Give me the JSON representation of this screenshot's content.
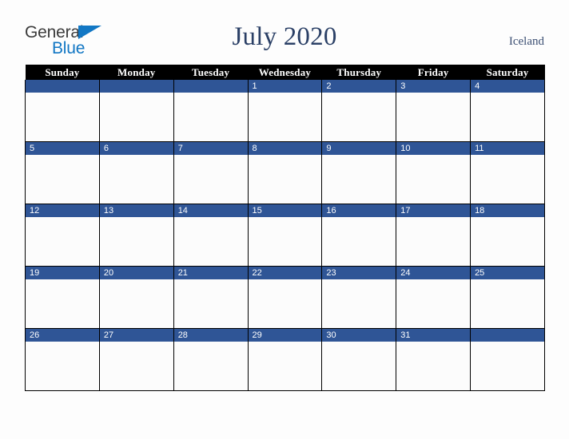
{
  "brand": {
    "name_part1": "General",
    "name_part2": "Blue",
    "triangle_icon": "triangle-icon"
  },
  "header": {
    "title": "July 2020",
    "region": "Iceland"
  },
  "colors": {
    "date_bar": "#2F5596",
    "header_row": "#000000",
    "title_text": "#2B4066",
    "region_text": "#3C4F73",
    "brand_blue": "#1277C4",
    "cell_background": "#FCFCFC",
    "page_background": "#FDFDFD"
  },
  "calendar": {
    "month": "July",
    "year": "2020",
    "weekday_headers": [
      "Sunday",
      "Monday",
      "Tuesday",
      "Wednesday",
      "Thursday",
      "Friday",
      "Saturday"
    ],
    "weeks": [
      [
        "",
        "",
        "",
        "1",
        "2",
        "3",
        "4"
      ],
      [
        "5",
        "6",
        "7",
        "8",
        "9",
        "10",
        "11"
      ],
      [
        "12",
        "13",
        "14",
        "15",
        "16",
        "17",
        "18"
      ],
      [
        "19",
        "20",
        "21",
        "22",
        "23",
        "24",
        "25"
      ],
      [
        "26",
        "27",
        "28",
        "29",
        "30",
        "31",
        ""
      ]
    ]
  }
}
